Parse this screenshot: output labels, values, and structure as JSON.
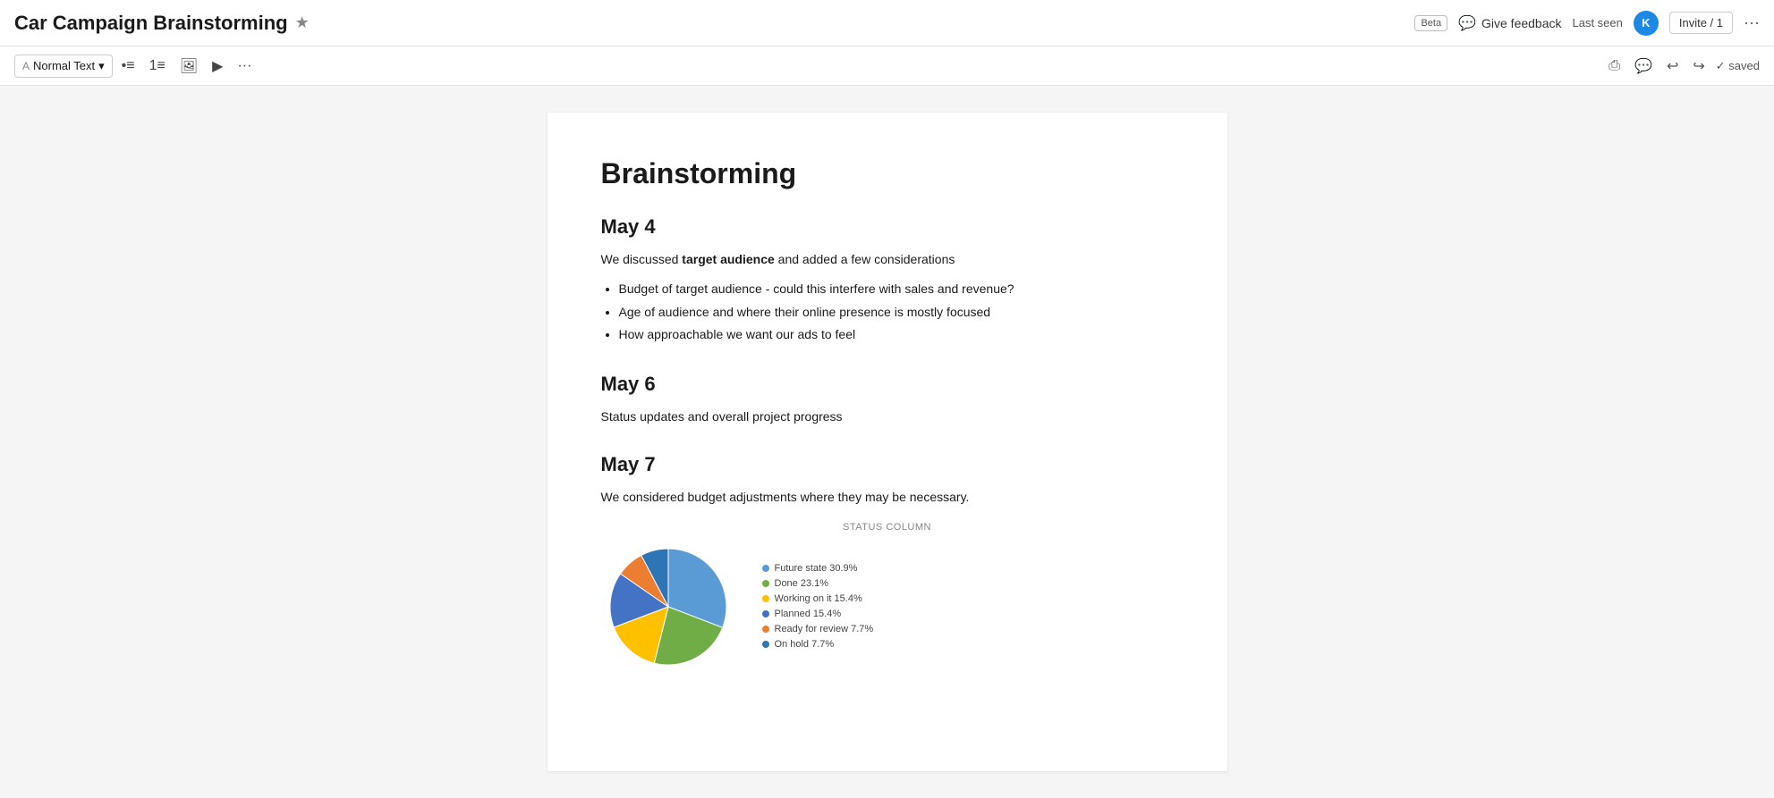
{
  "header": {
    "title": "Car Campaign Brainstorming",
    "star_label": "★",
    "beta_label": "Beta",
    "give_feedback_label": "Give feedback",
    "last_seen_label": "Last seen",
    "avatar_letter": "K",
    "invite_label": "Invite / 1",
    "more_label": "···"
  },
  "toolbar": {
    "text_style_label": "Normal Text",
    "dropdown_arrow": "▾",
    "bullet_list_icon": "≡",
    "numbered_list_icon": "≣",
    "image_icon": "⊞",
    "media_icon": "▶",
    "more_icon": "···",
    "print_icon": "⎙",
    "comment_icon": "💬",
    "undo_icon": "↩",
    "redo_icon": "↪",
    "saved_label": "✓ saved"
  },
  "document": {
    "main_title": "Brainstorming",
    "sections": [
      {
        "id": "section-may4",
        "heading": "May 4",
        "paragraph_before": "We discussed",
        "bold_word": "target audience",
        "paragraph_after": " and added a few considerations",
        "bullets": [
          "Budget of target audience - could this interfere with sales and revenue?",
          "Age of audience and where their online presence is mostly focused",
          "How approachable we want our ads to feel"
        ]
      },
      {
        "id": "section-may6",
        "heading": "May 6",
        "paragraph": "Status updates and overall project progress"
      },
      {
        "id": "section-may7",
        "heading": "May 7",
        "paragraph": "We considered budget adjustments where they may be necessary.",
        "chart": {
          "label": "STATUS COLUMN",
          "segments": [
            {
              "label": "Future state",
              "percent": 30.9,
              "color": "#5b9bd5",
              "start": 0,
              "end": 111.24
            },
            {
              "label": "Done",
              "percent": 23.1,
              "color": "#70ad47",
              "start": 111.24,
              "end": 194.4
            },
            {
              "label": "Working on it",
              "percent": 15.4,
              "color": "#ffc000",
              "start": 194.4,
              "end": 249.84
            },
            {
              "label": "Planned",
              "percent": 15.4,
              "color": "#4472c4",
              "start": 249.84,
              "end": 305.28
            },
            {
              "label": "Ready for review",
              "percent": 7.7,
              "color": "#ed7d31",
              "start": 305.28,
              "end": 333.0
            },
            {
              "label": "On hold",
              "percent": 7.7,
              "color": "#2e75b6",
              "start": 333.0,
              "end": 360.0
            }
          ],
          "legend_items": [
            {
              "label": "Future state 30.9%",
              "color": "#5b9bd5"
            },
            {
              "label": "Done 23.1%",
              "color": "#70ad47"
            },
            {
              "label": "Working on it 15.4%",
              "color": "#ffc000"
            },
            {
              "label": "Planned 15.4%",
              "color": "#4472c4"
            },
            {
              "label": "Ready for review 7.7%",
              "color": "#ed7d31"
            },
            {
              "label": "On hold 7.7%",
              "color": "#2e75b6"
            }
          ]
        }
      }
    ]
  }
}
